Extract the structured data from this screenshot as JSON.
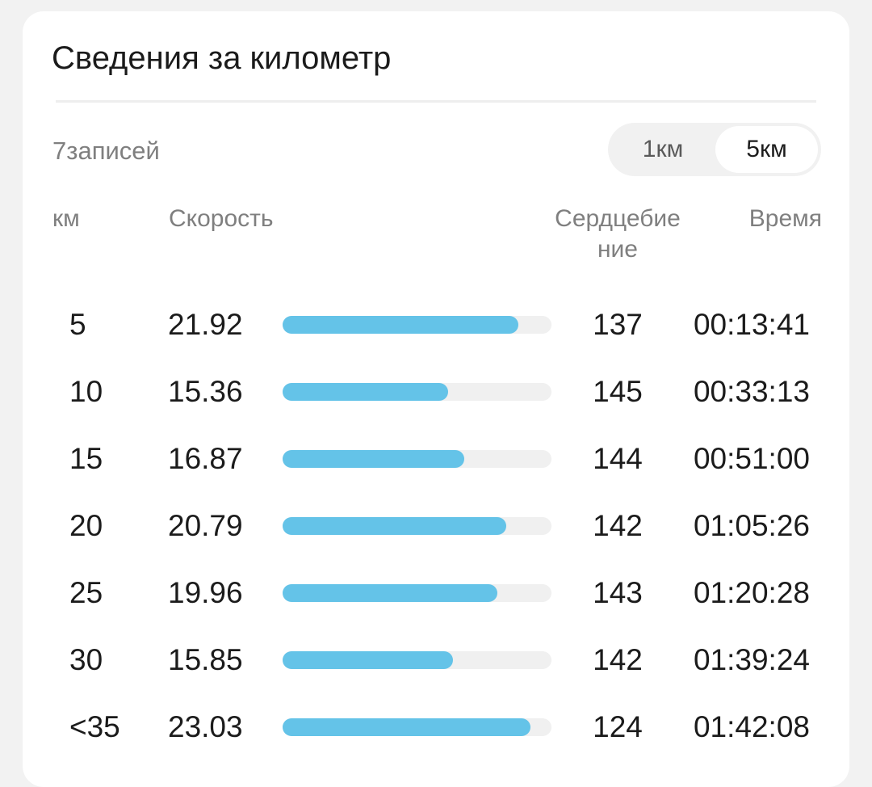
{
  "header": {
    "title": "Сведения за километр"
  },
  "summary": {
    "records": "7записей"
  },
  "toggle": {
    "options": [
      {
        "label": "1км",
        "selected": false
      },
      {
        "label": "5км",
        "selected": true
      }
    ]
  },
  "columns": {
    "km": "км",
    "speed": "Скорость",
    "heart_rate": "Сердцебиение",
    "time": "Время"
  },
  "colors": {
    "bar_fill": "#64c3e8",
    "bar_track": "#f0f0f0"
  },
  "speed_bar_max": 25,
  "rows": [
    {
      "km": "5",
      "speed": "21.92",
      "speed_value": 21.92,
      "heart_rate": "137",
      "time": "00:13:41"
    },
    {
      "km": "10",
      "speed": "15.36",
      "speed_value": 15.36,
      "heart_rate": "145",
      "time": "00:33:13"
    },
    {
      "km": "15",
      "speed": "16.87",
      "speed_value": 16.87,
      "heart_rate": "144",
      "time": "00:51:00"
    },
    {
      "km": "20",
      "speed": "20.79",
      "speed_value": 20.79,
      "heart_rate": "142",
      "time": "01:05:26"
    },
    {
      "km": "25",
      "speed": "19.96",
      "speed_value": 19.96,
      "heart_rate": "143",
      "time": "01:20:28"
    },
    {
      "km": "30",
      "speed": "15.85",
      "speed_value": 15.85,
      "heart_rate": "142",
      "time": "01:39:24"
    },
    {
      "km": "<35",
      "speed": "23.03",
      "speed_value": 23.03,
      "heart_rate": "124",
      "time": "01:42:08"
    }
  ]
}
